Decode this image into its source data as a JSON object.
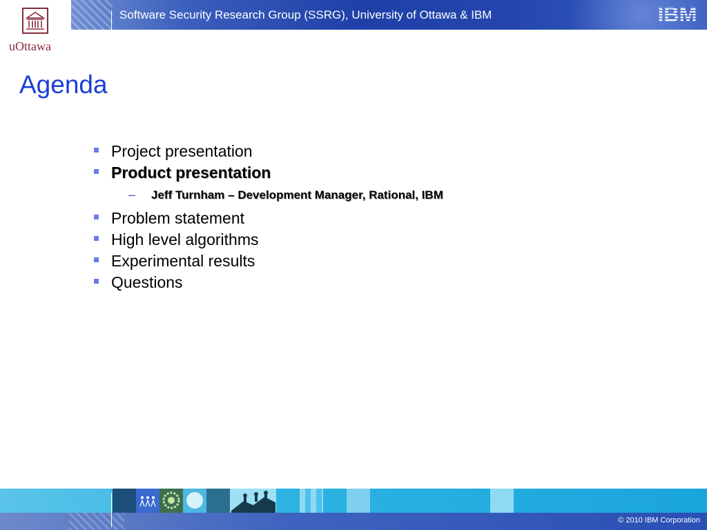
{
  "header": {
    "title": "Software Security Research Group (SSRG), University of Ottawa & IBM",
    "ibm_logo_text": "IBM"
  },
  "university_logo": {
    "text": "uOttawa",
    "icon": "building-icon"
  },
  "slide": {
    "title": "Agenda",
    "items": [
      {
        "label": "Project presentation",
        "bold": false
      },
      {
        "label": "Product presentation",
        "bold": true,
        "subitems": [
          {
            "marker": "–",
            "label": "Jeff Turnham – Development Manager, Rational, IBM"
          }
        ]
      },
      {
        "label": "Problem statement",
        "bold": false
      },
      {
        "label": "High level algorithms",
        "bold": false
      },
      {
        "label": "Experimental results",
        "bold": false
      },
      {
        "label": "Questions",
        "bold": false
      }
    ]
  },
  "footer": {
    "copyright": "© 2010 IBM Corporation"
  },
  "colors": {
    "title_blue": "#1a3fd6",
    "bullet": "#6b7be8",
    "header_blue": "#1e40a8",
    "footer_cyan": "#2cb3e2",
    "uottawa_red": "#8a2a3a"
  }
}
